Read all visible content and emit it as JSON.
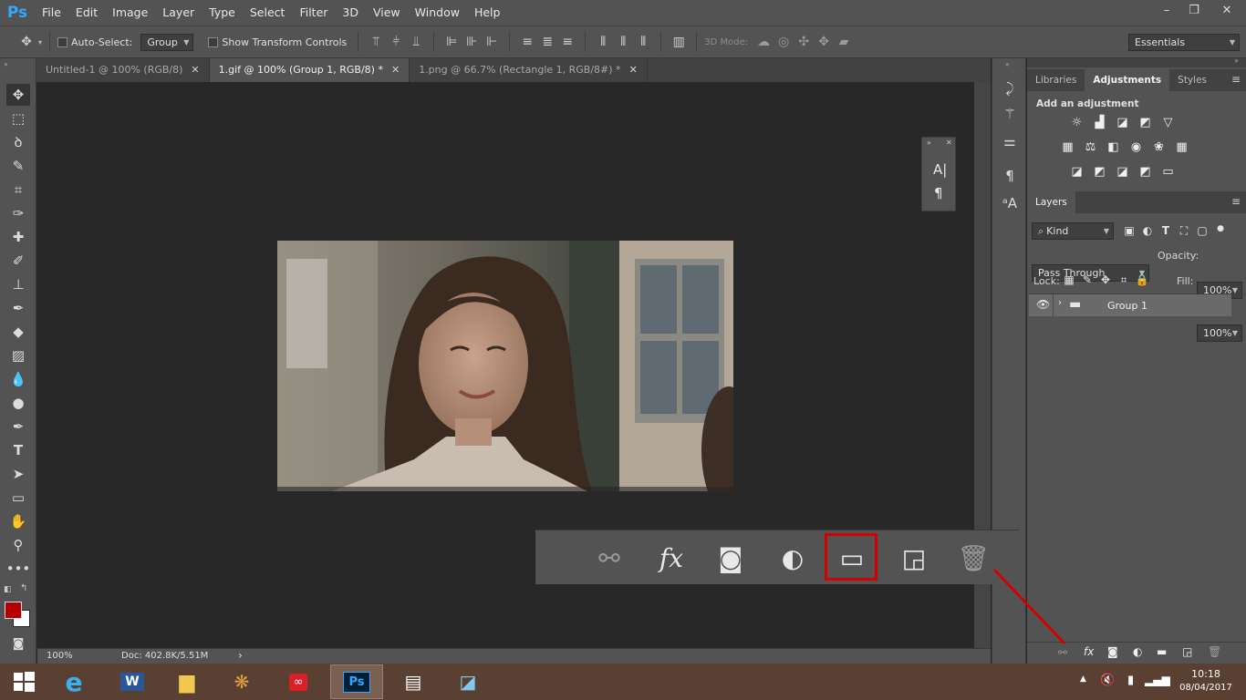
{
  "app": {
    "logo": "Ps"
  },
  "menu": [
    "File",
    "Edit",
    "Image",
    "Layer",
    "Type",
    "Select",
    "Filter",
    "3D",
    "View",
    "Window",
    "Help"
  ],
  "window_controls": {
    "minimize": "–",
    "restore": "❐",
    "close": "✕"
  },
  "options": {
    "auto_select_label": "Auto-Select:",
    "auto_select_value": "Group",
    "show_transform_label": "Show Transform Controls",
    "mode_3d_label": "3D Mode:",
    "workspace": "Essentials"
  },
  "tabs": [
    {
      "label": "Untitled-1 @ 100% (RGB/8)",
      "close": "✕"
    },
    {
      "label": "1.gif @ 100% (Group 1, RGB/8) *",
      "close": "✕"
    },
    {
      "label": "1.png @ 66.7% (Rectangle 1, RGB/8#) *",
      "close": "✕"
    }
  ],
  "status": {
    "zoom": "100%",
    "doc": "Doc: 402.8K/5.51M",
    "arrow": "›"
  },
  "panel_tabs": [
    "Libraries",
    "Adjustments",
    "Styles"
  ],
  "adjustments": {
    "heading": "Add an adjustment"
  },
  "layers": {
    "tab": "Layers",
    "filter_kind": "Kind",
    "blend_mode": "Pass Through",
    "opacity_label": "Opacity:",
    "opacity_value": "100%",
    "lock_label": "Lock:",
    "fill_label": "Fill:",
    "fill_value": "100%",
    "items": [
      {
        "name": "Group 1"
      }
    ]
  },
  "colors": {
    "foreground": "#b40000",
    "background": "#ffffff",
    "highlight": "#d40000",
    "ps_blue": "#31a8ff"
  },
  "clock": {
    "time": "10:18",
    "date": "08/04/2017"
  }
}
